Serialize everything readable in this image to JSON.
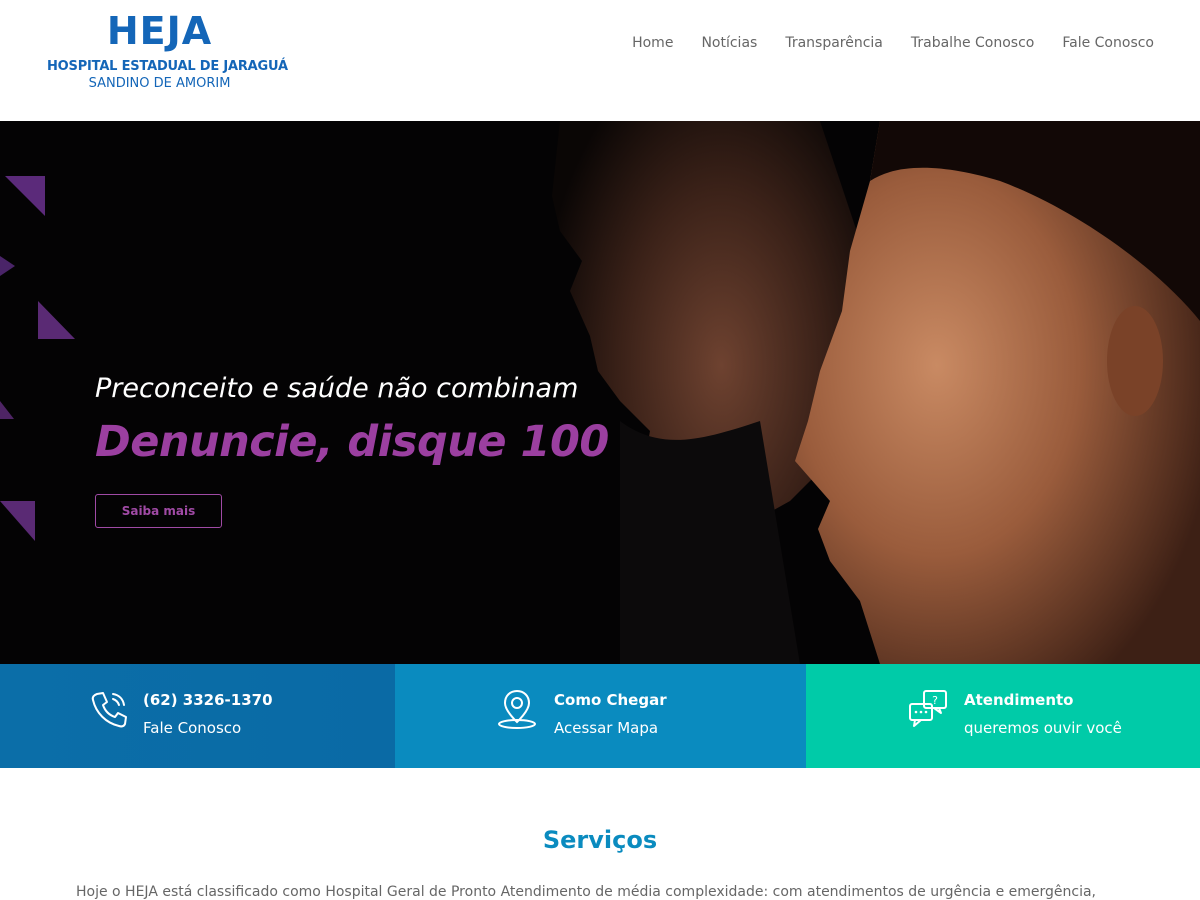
{
  "header": {
    "logo": {
      "mark": "HEJA",
      "line1": "HOSPITAL ESTADUAL DE JARAGUÁ",
      "line2": "SANDINO DE AMORIM"
    },
    "nav": [
      {
        "label": "Home"
      },
      {
        "label": "Notícias"
      },
      {
        "label": "Transparência"
      },
      {
        "label": "Trabalhe Conosco"
      },
      {
        "label": "Fale Conosco"
      }
    ]
  },
  "hero": {
    "subtitle": "Preconceito e saúde não combinam",
    "title": "Denuncie, disque 100",
    "button_label": "Saiba mais"
  },
  "infobar": [
    {
      "icon": "phone-icon",
      "title": "(62) 3326-1370",
      "subtitle": "Fale Conosco",
      "color": "#0b6ea8"
    },
    {
      "icon": "map-pin-icon",
      "title": "Como Chegar",
      "subtitle": "Acessar Mapa",
      "color": "#0a8bbf"
    },
    {
      "icon": "chat-icon",
      "title": "Atendimento",
      "subtitle": "queremos ouvir você",
      "color": "#00cba8"
    }
  ],
  "services": {
    "title": "Serviços",
    "text": "Hoje o HEJA está classificado como Hospital Geral de Pronto Atendimento de média complexidade: com atendimentos de urgência e emergência,"
  },
  "colors": {
    "brand_blue": "#1466b8",
    "accent_purple": "#9b3fa0",
    "teal": "#00cba8"
  }
}
